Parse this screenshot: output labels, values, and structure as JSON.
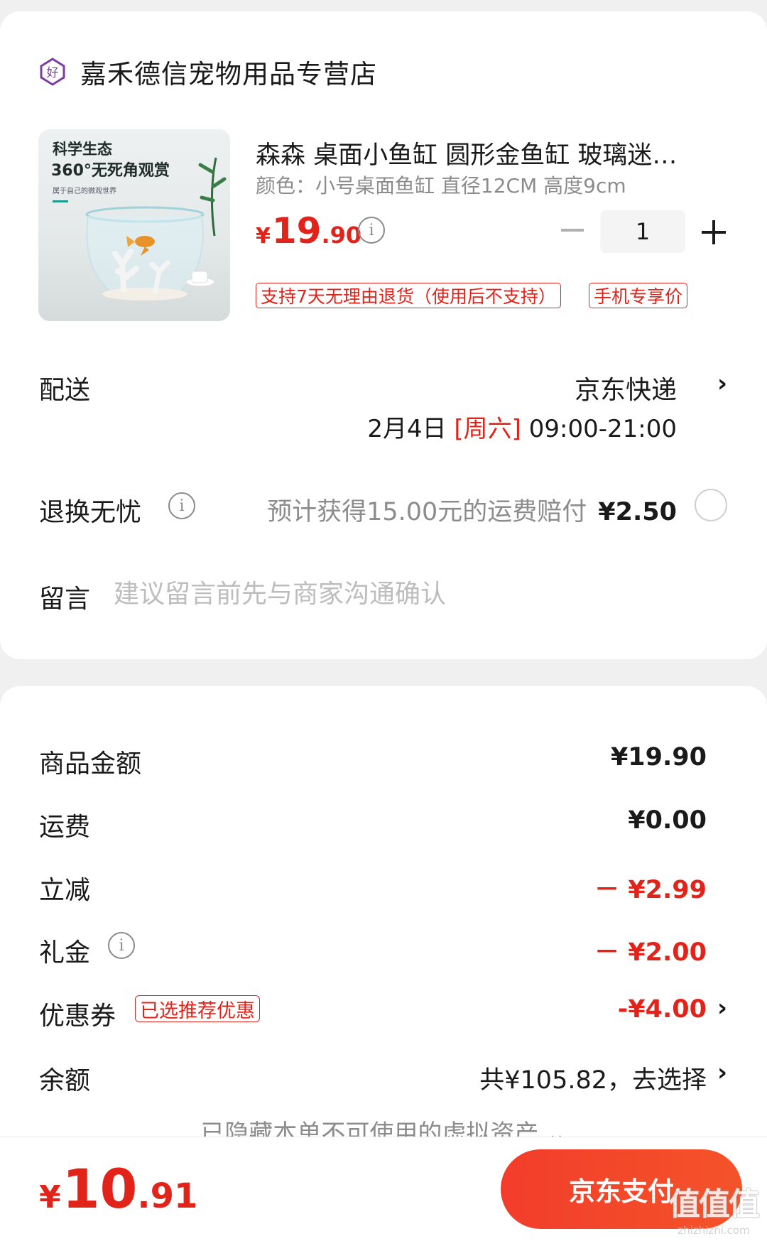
{
  "store": {
    "name": "嘉禾德信宠物用品专营店",
    "icon": "good-store-badge-icon"
  },
  "product": {
    "image_text": {
      "line1": "科学生态",
      "line2": "360°无死角观赏",
      "line3": "属于自己的微观世界"
    },
    "title": "森森 桌面小鱼缸 圆形金鱼缸 玻璃迷…",
    "spec": "颜色：小号桌面鱼缸  直径12CM 高度9cm",
    "price": {
      "symbol": "¥",
      "integer": "19",
      "decimal": ".90"
    },
    "quantity": "1",
    "tags": [
      "支持7天无理由退货（使用后不支持）",
      "手机专享价"
    ]
  },
  "delivery": {
    "label": "配送",
    "method": "京东快递",
    "date": "2月4日",
    "day": "[周六]",
    "time": "09:00-21:00"
  },
  "return_insurance": {
    "label": "退换无忧",
    "description": "预计获得15.00元的运费赔付",
    "price": "¥2.50"
  },
  "message": {
    "label": "留言",
    "placeholder": "建议留言前先与商家沟通确认"
  },
  "summary": {
    "goods_label": "商品金额",
    "goods_value": "¥19.90",
    "shipping_label": "运费",
    "shipping_value": "¥0.00",
    "discount_label": "立减",
    "discount_value": "－ ¥2.99",
    "gift_label": "礼金",
    "gift_value": "－ ¥2.00",
    "coupon_label": "优惠券",
    "coupon_tag": "已选推荐优惠",
    "coupon_value": "-¥4.00",
    "balance_label": "余额",
    "balance_value": "共¥105.82，去选择",
    "hidden_hint": "已隐藏本单不可使用的虚拟资产 ⌄"
  },
  "footer": {
    "total": {
      "symbol": "¥",
      "integer": "10",
      "decimal": ".91"
    },
    "pay_label": "京东支付",
    "watermark_logo": "值值值",
    "watermark_url": "zhizhizhi.com"
  },
  "colors": {
    "accent": "#e2231a",
    "pay_button": "#f23d2b",
    "muted": "#8c8c8c"
  }
}
